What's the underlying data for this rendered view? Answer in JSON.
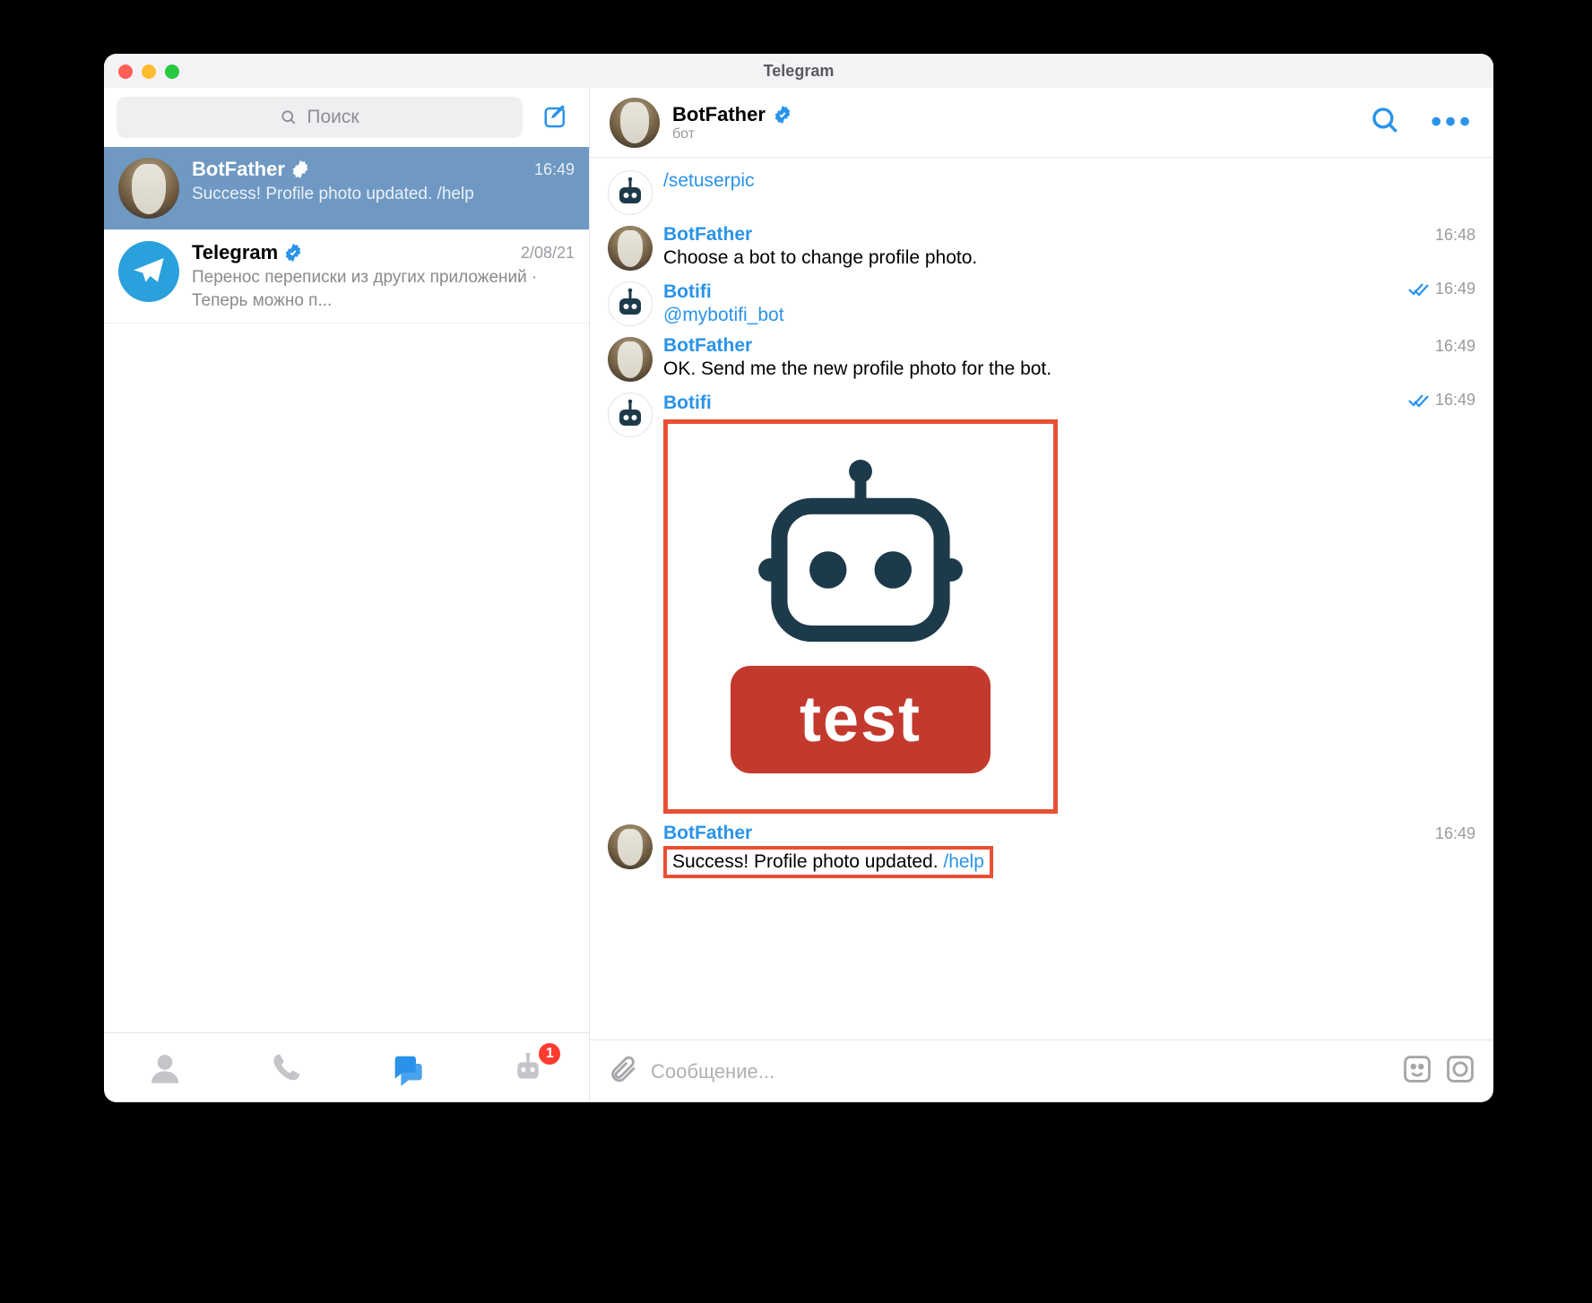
{
  "window": {
    "title": "Telegram"
  },
  "search": {
    "placeholder": "Поиск"
  },
  "chats": [
    {
      "name": "BotFather",
      "verified": true,
      "time": "16:49",
      "preview": "Success! Profile photo updated. /help",
      "active": true,
      "avatar": "botfather"
    },
    {
      "name": "Telegram",
      "verified": true,
      "time": "2/08/21",
      "preview": "Перенос переписки из других приложений  · Теперь можно п...",
      "active": false,
      "avatar": "telegram"
    }
  ],
  "bottom_nav": {
    "badge": "1"
  },
  "header": {
    "name": "BotFather",
    "verified": true,
    "subtitle": "бот"
  },
  "messages": [
    {
      "sender": "",
      "avatar": "bot",
      "body_link": "/setuserpic",
      "time": "",
      "ticks": false
    },
    {
      "sender": "BotFather",
      "avatar": "botfather",
      "body": "Choose a bot to change profile photo.",
      "time": "16:48",
      "ticks": false
    },
    {
      "sender": "Botifi",
      "avatar": "bot",
      "body_link": "@mybotifi_bot",
      "time": "16:49",
      "ticks": true
    },
    {
      "sender": "BotFather",
      "avatar": "botfather",
      "body": "OK. Send me the new profile photo for the bot.",
      "time": "16:49",
      "ticks": false
    },
    {
      "sender": "Botifi",
      "avatar": "bot",
      "image": {
        "label": "test"
      },
      "time": "16:49",
      "ticks": true
    },
    {
      "sender": "BotFather",
      "avatar": "botfather",
      "body": "Success! Profile photo updated. ",
      "body_link": "/help",
      "time": "16:49",
      "ticks": false,
      "highlight": true
    }
  ],
  "composer": {
    "placeholder": "Сообщение..."
  }
}
